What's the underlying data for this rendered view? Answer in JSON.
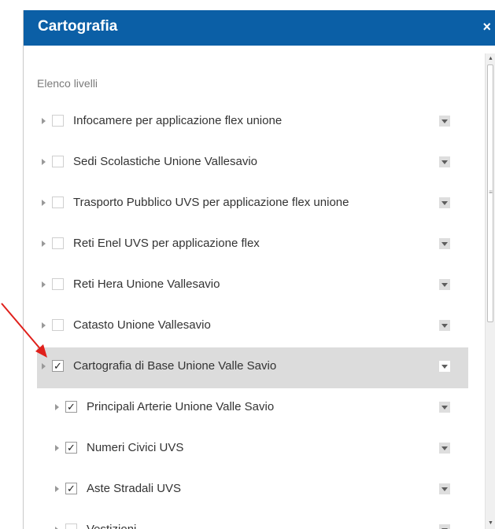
{
  "window": {
    "title": "Cartografia",
    "close_glyph": "×"
  },
  "list_header": "Elenco livelli",
  "layers": [
    {
      "label": "Infocamere per applicazione flex unione",
      "checked": false,
      "level": 0
    },
    {
      "label": "Sedi Scolastiche Unione Vallesavio",
      "checked": false,
      "level": 0
    },
    {
      "label": "Trasporto Pubblico UVS per applicazione flex unione",
      "checked": false,
      "level": 0
    },
    {
      "label": "Reti Enel UVS per applicazione flex",
      "checked": false,
      "level": 0
    },
    {
      "label": "Reti Hera Unione Vallesavio",
      "checked": false,
      "level": 0
    },
    {
      "label": "Catasto Unione Vallesavio",
      "checked": false,
      "level": 0
    },
    {
      "label": "Cartografia di Base Unione Valle Savio",
      "checked": true,
      "level": 0,
      "selected": true
    },
    {
      "label": "Principali Arterie Unione Valle Savio",
      "checked": true,
      "level": 1
    },
    {
      "label": "Numeri Civici UVS",
      "checked": true,
      "level": 1
    },
    {
      "label": "Aste Stradali UVS",
      "checked": true,
      "level": 1
    },
    {
      "label": "Vestizioni",
      "checked": false,
      "level": 1
    }
  ],
  "colors": {
    "title_bar": "#0b5fa6",
    "selected_row": "#dcdcdc",
    "annotation_arrow": "#e0201b"
  },
  "icons": {
    "expand": "expand-arrow-icon",
    "layer_menu": "dropdown-menu-icon",
    "scroll_up": "scroll-up-icon",
    "scroll_down": "scroll-down-icon"
  }
}
